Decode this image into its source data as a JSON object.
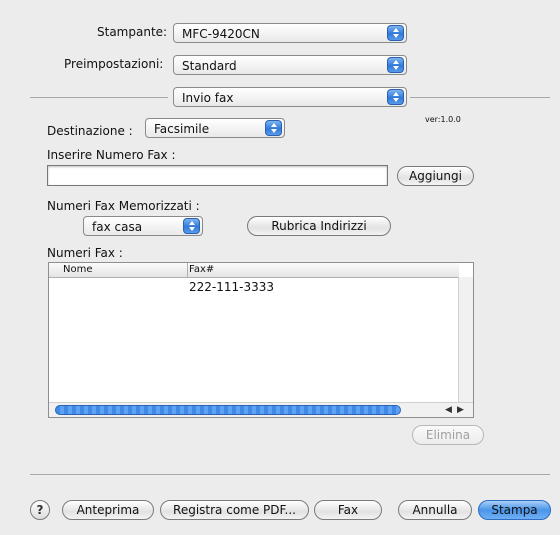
{
  "printer": {
    "label": "Stampante:",
    "value": "MFC-9420CN"
  },
  "presets": {
    "label": "Preimpostazioni:",
    "value": "Standard"
  },
  "panel": {
    "value": "Invio fax"
  },
  "version": "ver:1.0.0",
  "destination": {
    "label": "Destinazione :",
    "value": "Facsimile"
  },
  "fax_number": {
    "label": "Inserire Numero Fax :",
    "value": "",
    "add_label": "Aggiungi"
  },
  "stored": {
    "label": "Numeri Fax Memorizzati :",
    "value": "fax casa",
    "address_book_label": "Rubrica Indirizzi"
  },
  "fax_list": {
    "label": "Numeri Fax :",
    "columns": [
      "Nome",
      "Fax#"
    ],
    "rows": [
      {
        "name": "",
        "fax": "222-111-3333"
      }
    ],
    "delete_label": "Elimina"
  },
  "footer": {
    "help": "?",
    "preview": "Anteprima",
    "save_pdf": "Registra come PDF...",
    "fax": "Fax",
    "cancel": "Annulla",
    "print": "Stampa"
  },
  "colors": {
    "accent": "#4a95ea",
    "background": "#ececec"
  }
}
